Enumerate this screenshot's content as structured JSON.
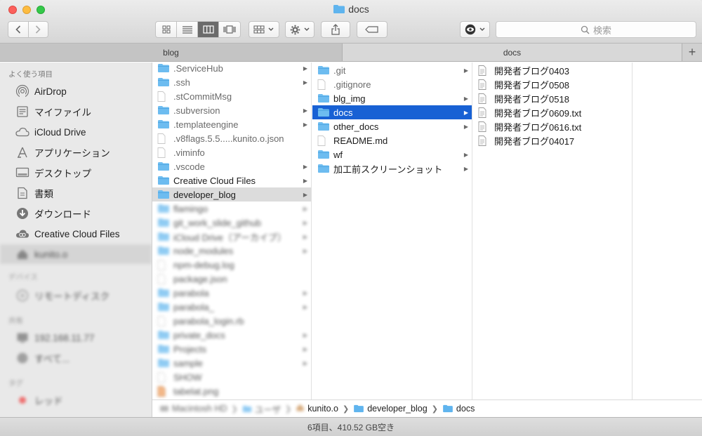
{
  "window": {
    "title": "docs"
  },
  "toolbar": {
    "search_placeholder": "検索"
  },
  "tabs": [
    {
      "label": "blog"
    },
    {
      "label": "docs"
    }
  ],
  "sidebar": {
    "favorites_header": "よく使う項目",
    "items": [
      {
        "label": "AirDrop",
        "icon": "airdrop-icon"
      },
      {
        "label": "マイファイル",
        "icon": "all-files-icon"
      },
      {
        "label": "iCloud Drive",
        "icon": "cloud-icon"
      },
      {
        "label": "アプリケーション",
        "icon": "applications-icon"
      },
      {
        "label": "デスクトップ",
        "icon": "desktop-icon"
      },
      {
        "label": "書類",
        "icon": "documents-icon"
      },
      {
        "label": "ダウンロード",
        "icon": "downloads-icon"
      },
      {
        "label": "Creative Cloud Files",
        "icon": "creative-cloud-icon"
      },
      {
        "label": "kunito.o",
        "icon": "home-icon"
      }
    ],
    "devices_header": "デバイス",
    "devices": [
      {
        "label": "リモートディスク"
      }
    ],
    "shared_header": "共有",
    "shared": [
      {
        "label": "192.168.11.77"
      },
      {
        "label": "すべて..."
      }
    ],
    "tags_header": "タグ",
    "tags": [
      {
        "label": "レッド"
      }
    ]
  },
  "column1": [
    {
      "label": ".ServiceHub",
      "type": "folder",
      "arrow": true
    },
    {
      "label": ".ssh",
      "type": "folder",
      "arrow": true
    },
    {
      "label": ".stCommitMsg",
      "type": "file",
      "arrow": false
    },
    {
      "label": ".subversion",
      "type": "folder",
      "arrow": true
    },
    {
      "label": ".templateengine",
      "type": "folder",
      "arrow": true
    },
    {
      "label": ".v8flags.5.5.....kunito.o.json",
      "type": "file",
      "arrow": false
    },
    {
      "label": ".viminfo",
      "type": "file",
      "arrow": false
    },
    {
      "label": ".vscode",
      "type": "folder",
      "arrow": true
    },
    {
      "label": "Creative Cloud Files",
      "type": "folder",
      "arrow": true
    },
    {
      "label": "developer_blog",
      "type": "folder",
      "arrow": true
    },
    {
      "label": "flamingo",
      "type": "folder",
      "arrow": true
    },
    {
      "label": "git_work_slide_github",
      "type": "folder",
      "arrow": true
    },
    {
      "label": "iCloud Drive（アーカイブ）",
      "type": "folder",
      "arrow": true
    },
    {
      "label": "node_modules",
      "type": "folder",
      "arrow": true
    },
    {
      "label": "npm-debug.log",
      "type": "file",
      "arrow": false
    },
    {
      "label": "package.json",
      "type": "file",
      "arrow": false
    },
    {
      "label": "parabola",
      "type": "folder",
      "arrow": true
    },
    {
      "label": "parabola_",
      "type": "folder",
      "arrow": true
    },
    {
      "label": "parabola_login.rb",
      "type": "file",
      "arrow": false
    },
    {
      "label": "private_docs",
      "type": "folder",
      "arrow": true
    },
    {
      "label": "Projects",
      "type": "folder",
      "arrow": true
    },
    {
      "label": "sample",
      "type": "folder",
      "arrow": true
    },
    {
      "label": "SHOW",
      "type": "file",
      "arrow": false
    },
    {
      "label": "tabelat.png",
      "type": "image",
      "arrow": false
    }
  ],
  "column2": [
    {
      "label": ".git",
      "type": "folder",
      "arrow": true
    },
    {
      "label": ".gitignore",
      "type": "file",
      "arrow": false
    },
    {
      "label": "blg_img",
      "type": "folder",
      "arrow": true
    },
    {
      "label": "docs",
      "type": "folder",
      "arrow": true
    },
    {
      "label": "other_docs",
      "type": "folder",
      "arrow": true
    },
    {
      "label": "README.md",
      "type": "file",
      "arrow": false
    },
    {
      "label": "wf",
      "type": "folder",
      "arrow": true
    },
    {
      "label": "加工前スクリーンショット",
      "type": "folder",
      "arrow": true
    }
  ],
  "column3": [
    {
      "label": "開発者ブログ0403",
      "type": "doc"
    },
    {
      "label": "開発者ブログ0508",
      "type": "doc"
    },
    {
      "label": "開発者ブログ0518",
      "type": "doc"
    },
    {
      "label": "開発者ブログ0609.txt",
      "type": "doc"
    },
    {
      "label": "開発者ブログ0616.txt",
      "type": "doc"
    },
    {
      "label": "開発者ブログ04017",
      "type": "doc"
    }
  ],
  "pathbar": {
    "blurred": [
      "Macintosh HD",
      "ユーザ"
    ],
    "items": [
      "kunito.o",
      "developer_blog",
      "docs"
    ]
  },
  "status": {
    "text": "6項目、410.52 GB空き"
  },
  "colors": {
    "selection": "#1861d4",
    "folder": "#5fb4ee"
  }
}
